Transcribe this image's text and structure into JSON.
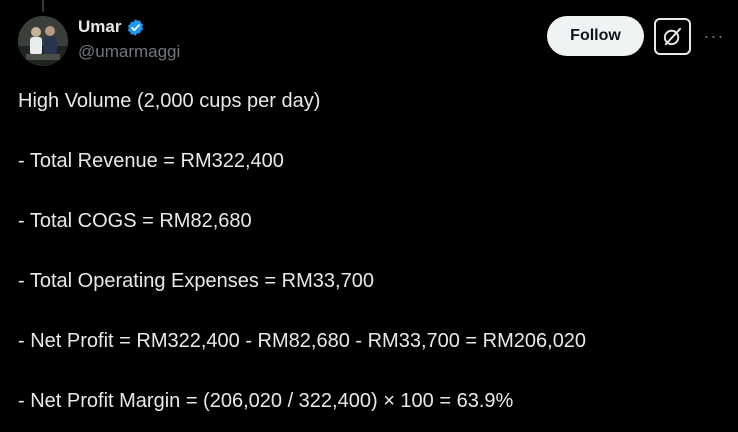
{
  "author": {
    "name": "Umar",
    "handle": "@umarmaggi"
  },
  "actions": {
    "follow_label": "Follow",
    "grok_icon": "grok-icon",
    "more_icon": "more-icon",
    "more_label": "···"
  },
  "colors": {
    "background": "#000000",
    "text": "#e7e9ea",
    "secondary": "#71767b",
    "verified": "#1d9bf0",
    "follow_bg": "#eff3f4"
  },
  "tweet": {
    "lines": [
      "High Volume (2,000 cups per day)",
      "- Total Revenue = RM322,400",
      "- Total COGS = RM82,680",
      "- Total Operating Expenses = RM33,700",
      "- Net Profit = RM322,400 - RM82,680 - RM33,700 = RM206,020",
      "- Net Profit Margin = (206,020 / 322,400) × 100 = 63.9%"
    ]
  }
}
